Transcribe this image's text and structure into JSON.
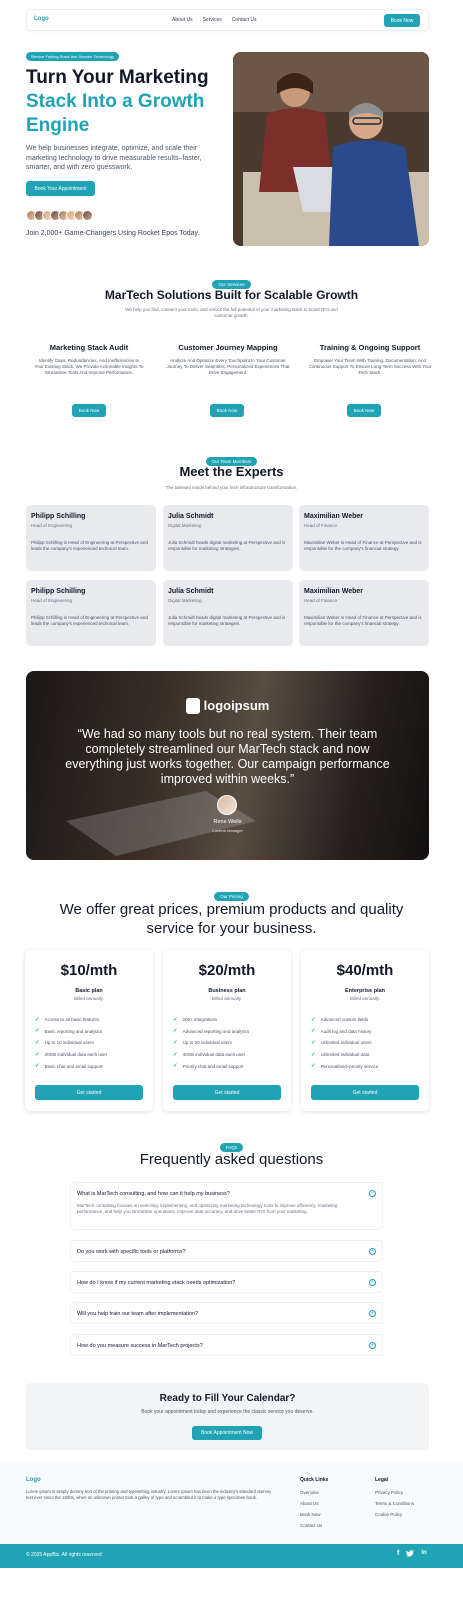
{
  "header": {
    "logo": "Logo",
    "nav": [
      "About Us",
      "Services",
      "Contact Us"
    ],
    "cta": "Book Now"
  },
  "hero": {
    "tag": "Service Fueling Stack Ask Smarter Technology",
    "title_line1": "Turn Your Marketing",
    "title_line2": "Stack Into a Growth",
    "title_line3": "Engine",
    "description": "We help businesses integrate, optimize, and scale their marketing technology to drive measurable results–faster, smarter, and with zero guesswork.",
    "button": "Book Your Appointment",
    "join_text": "Join 2,000+ Game-Changers Using Rocket Epos Today.",
    "avatar_count": 8
  },
  "services": {
    "tag": "Our Services",
    "title": "MarTech Solutions Built for Scalable Growth",
    "subtitle": "We help you find, connect your tools, and unlock the full potential of your marketing stack to boost ROI and customer growth.",
    "items": [
      {
        "title": "Marketing Stack Audit",
        "description": "Identify Gaps, Redundancies, And Inefficiencies In Your Existing Stack. We Provide Actionable Insights To Streamline Tools And Improve Performance.",
        "button": "Book Now"
      },
      {
        "title": "Customer Journey Mapping",
        "description": "Analyze And Optimize Every Touchpoint In Your Customer Journey To Deliver Seamless, Personalized Experiences That Drive Engagement.",
        "button": "Book Now"
      },
      {
        "title": "Training & Ongoing Support",
        "description": "Empower Your Team With Training, Documentation, And Continuous Support To Ensure Long-Term Success With Your Tech Stack.",
        "button": "Book Now"
      }
    ]
  },
  "experts": {
    "tag": "Our Team Members",
    "title": "Meet the Experts",
    "subtitle": "The talented minds behind your tech infrastructure transformation.",
    "cards": [
      {
        "name": "Philipp Schilling",
        "role": "Head of Engineering",
        "bio": "Philipp Schilling is Head of Engineering at Perspective and leads the company's experienced technical team."
      },
      {
        "name": "Julia Schmidt",
        "role": "Digital Marketing",
        "bio": "Julia Schmidt heads digital marketing at Perspective and is responsible for marketing strategies."
      },
      {
        "name": "Maximilian Weber",
        "role": "Head of Finance",
        "bio": "Maximilian Weber is Head of Finance at Perspective and is responsible for the company's financial strategy."
      },
      {
        "name": "Philipp Schilling",
        "role": "Head of Engineering",
        "bio": "Philipp Schilling is Head of Engineering at Perspective and leads the company's experienced technical team."
      },
      {
        "name": "Julia Schmidt",
        "role": "Digital Marketing",
        "bio": "Julia Schmidt heads digital marketing at Perspective and is responsible for marketing strategies."
      },
      {
        "name": "Maximilian Weber",
        "role": "Head of Finance",
        "bio": "Maximilian Weber is Head of Finance at Perspective and is responsible for the company's financial strategy."
      }
    ]
  },
  "testimonial": {
    "logo": "logoipsum",
    "quote": "“We had so many tools but no real system. Their team completely streamlined our MarTech stack and now everything just works together. Our campaign performance improved within weeks.”",
    "name": "Rene Wells",
    "role": "Content Manager"
  },
  "pricing": {
    "tag": "Our Pricing",
    "title": "We offer great prices, premium products and quality service for your business.",
    "plans": [
      {
        "price": "$10/mth",
        "name": "Basic plan",
        "billing": "Billed annually.",
        "features": [
          "Access to all basic features",
          "Basic reporting and analytics",
          "Up to 10 individual users",
          "20GB individual data each user",
          "Basic chat and email support"
        ],
        "button": "Get started"
      },
      {
        "price": "$20/mth",
        "name": "Business plan",
        "billing": "Billed annually.",
        "features": [
          "200+ integrations",
          "Advanced reporting and analytics",
          "Up to 20 individual users",
          "40GB individual data each user",
          "Priority chat and email support"
        ],
        "button": "Get started"
      },
      {
        "price": "$40/mth",
        "name": "Enterprise plan",
        "billing": "Billed annually.",
        "features": [
          "Advanced custom fields",
          "Audit log and data history",
          "Unlimited individual users",
          "Unlimited individual data",
          "Personalised+priority service"
        ],
        "button": "Get started"
      }
    ]
  },
  "faq": {
    "tag": "FAQs",
    "title": "Frequently asked questions",
    "items": [
      {
        "question": "What is MarTech consulting, and how can it help my business?",
        "answer": "MarTech consulting focuses on selecting, implementing, and optimizing marketing technology tools to improve efficiency, marketing performance, and help you streamline operations, improve data accuracy, and drive better ROI from your marketing."
      },
      {
        "question": "Do you work with specific tools or platforms?"
      },
      {
        "question": "How do I know if my current marketing stack needs optimization?"
      },
      {
        "question": "Will you help train our team after implementation?"
      },
      {
        "question": "How do you measure success in MarTech projects?"
      }
    ]
  },
  "cta": {
    "title": "Ready to Fill Your Calendar?",
    "subtitle": "Book your appointment today and experience the classic service you deserve.",
    "button": "Book Appointment Now"
  },
  "footer": {
    "logo": "Logo",
    "description": "Lorem ipsum is simply dummy text of the printing and typesetting industry. Lorem Ipsum has been the industry's standard dummy text ever since the 1500s, when an unknown printer took a galley of type and scrambled it to make a type specimen book.",
    "quick_links_title": "Quick Links",
    "quick_links": [
      "Overview",
      "About Us",
      "Book Now",
      "Contact Us"
    ],
    "legal_title": "Legal",
    "legal_links": [
      "Privacy Policy",
      "Terms & Conditions",
      "Cookie Policy"
    ],
    "copyright": "© 2025 AppBiz. All rights reserved",
    "social": [
      "facebook-icon",
      "twitter-icon",
      "linkedin-icon"
    ]
  },
  "colors": {
    "accent": "#1fa3b5",
    "check": "#22c55e"
  }
}
